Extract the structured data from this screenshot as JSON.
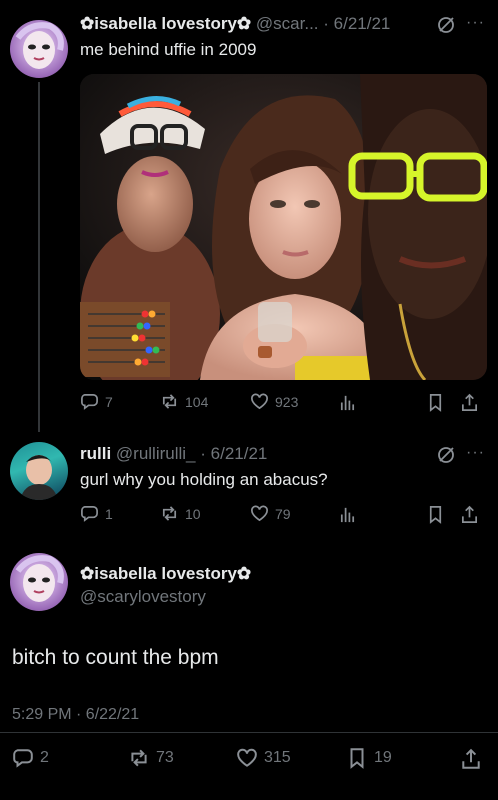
{
  "tweets": [
    {
      "display_name": "✿isabella lovestory✿",
      "handle": "@scar...",
      "date": "6/21/21",
      "text": "me behind uffie in 2009",
      "replies": "7",
      "reposts": "104",
      "likes": "923"
    },
    {
      "display_name": "rulli",
      "handle": "@rullirulli_",
      "date": "6/21/21",
      "text": "gurl why you holding an abacus?",
      "replies": "1",
      "reposts": "10",
      "likes": "79"
    }
  ],
  "main_tweet": {
    "display_name": "✿isabella lovestory✿",
    "handle": "@scarylovestory",
    "text": "bitch to count the bpm",
    "timestamp": "5:29 PM · 6/22/21",
    "replies": "2",
    "reposts": "73",
    "likes": "315",
    "bookmarks": "19"
  },
  "separator": "·",
  "more_label": "···",
  "colors": {
    "background": "#000000",
    "text": "#e7e9ea",
    "muted": "#71767b"
  }
}
